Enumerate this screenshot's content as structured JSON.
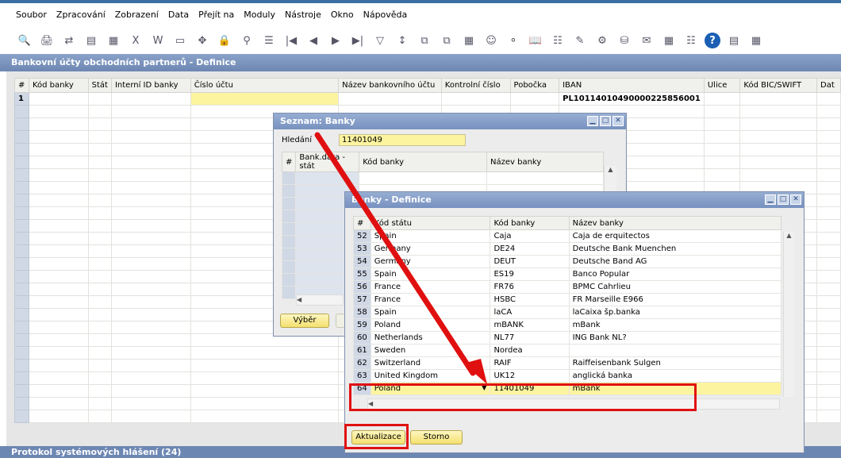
{
  "menu": [
    "Soubor",
    "Zpracování",
    "Zobrazení",
    "Data",
    "Přejít na",
    "Moduly",
    "Nástroje",
    "Okno",
    "Nápověda"
  ],
  "menu_underline": [
    "S",
    "Z",
    "Z",
    "D",
    "P",
    "M",
    "N",
    "O",
    "N"
  ],
  "toolbar_icons": [
    "preview-icon",
    "print-icon",
    "export-icon",
    "pdf-icon",
    "fax-icon",
    "excel-icon",
    "word-icon",
    "doc-icon",
    "move-icon",
    "lock-icon",
    "binoculars-icon",
    "form-icon",
    "first-icon",
    "prev-icon",
    "next-icon",
    "last-icon",
    "filter-icon",
    "sort-icon",
    "base-doc-icon",
    "target-doc-icon",
    "calc-icon",
    "users-icon",
    "tree-icon",
    "book-icon",
    "journal-icon",
    "edit-icon",
    "settings-icon",
    "db-icon",
    "alert-icon",
    "calendar-icon",
    "org-icon",
    "help-icon",
    "extra1-icon",
    "extra2-icon"
  ],
  "main": {
    "title": "Bankovní účty obchodních partnerů - Definice",
    "columns": [
      "#",
      "Kód banky",
      "Stát",
      "Interní ID banky",
      "Číslo účtu",
      "Název bankovního účtu",
      "Kontrolní číslo",
      "Pobočka",
      "IBAN",
      "Ulice",
      "Kód BIC/SWIFT",
      "Dat"
    ],
    "row1": {
      "num": "1",
      "iban": "PL10114010490000225856001"
    }
  },
  "status": "Protokol systémových hlášení (24)",
  "seznam": {
    "title": "Seznam: Banky",
    "search_label": "Hledání",
    "search_value": "11401049",
    "columns": [
      "#",
      "Bank.data - stát",
      "Kód banky",
      "Název banky"
    ],
    "select_btn": "Výběr"
  },
  "definice": {
    "title": "Banky - Definice",
    "columns": [
      "#",
      "Kód státu",
      "Kód banky",
      "Název banky"
    ],
    "rows": [
      {
        "n": "52",
        "country": "Spain",
        "code": "Caja",
        "name": "Caja de erquitectos"
      },
      {
        "n": "53",
        "country": "Germany",
        "code": "DE24",
        "name": "Deutsche Bank Muenchen"
      },
      {
        "n": "54",
        "country": "Germany",
        "code": "DEUT",
        "name": "Deutsche Band AG"
      },
      {
        "n": "55",
        "country": "Spain",
        "code": "ES19",
        "name": "Banco Popular"
      },
      {
        "n": "56",
        "country": "France",
        "code": "FR76",
        "name": "BPMC Cahrlieu"
      },
      {
        "n": "57",
        "country": "France",
        "code": "HSBC",
        "name": "FR Marseille E966"
      },
      {
        "n": "58",
        "country": "Spain",
        "code": "laCA",
        "name": "laCaixa šp.banka"
      },
      {
        "n": "59",
        "country": "Poland",
        "code": "mBANK",
        "name": "mBank"
      },
      {
        "n": "60",
        "country": "Netherlands",
        "code": "NL77",
        "name": "ING Bank NL?"
      },
      {
        "n": "61",
        "country": "Sweden",
        "code": "Nordea",
        "name": ""
      },
      {
        "n": "62",
        "country": "Switzerland",
        "code": "RAIF",
        "name": "Raiffeisenbank Sulgen"
      },
      {
        "n": "63",
        "country": "United Kingdom",
        "code": "UK12",
        "name": "anglická banka"
      }
    ],
    "new_row": {
      "n": "64",
      "country": "Poland",
      "code": "11401049",
      "name": "mBank"
    },
    "update_btn": "Aktualizace",
    "cancel_btn": "Storno"
  }
}
